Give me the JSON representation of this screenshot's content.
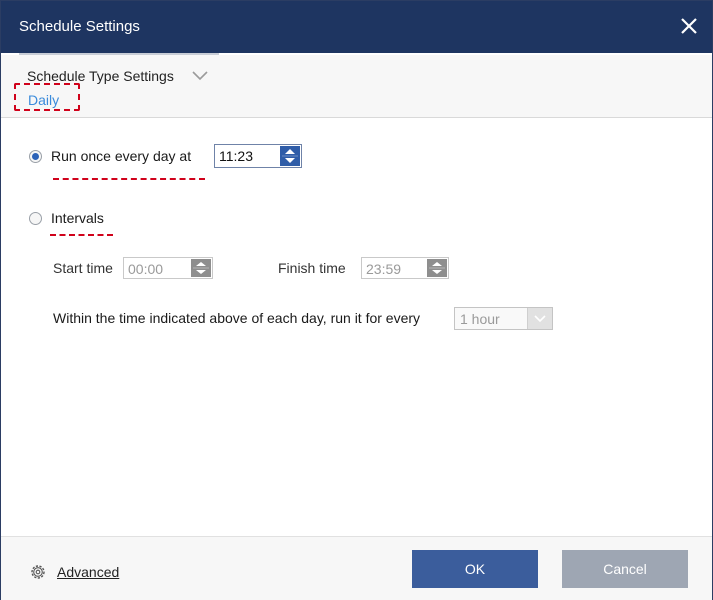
{
  "window": {
    "title": "Schedule Settings"
  },
  "schedule_type": {
    "label": "Schedule Type Settings",
    "selected": "Daily"
  },
  "options": {
    "run_once": {
      "label": "Run once every day at",
      "time": "11:23",
      "selected": true
    },
    "intervals": {
      "label": "Intervals",
      "selected": false
    },
    "start_time": {
      "label": "Start time",
      "value": "00:00"
    },
    "finish_time": {
      "label": "Finish time",
      "value": "23:59"
    },
    "within": {
      "label": "Within the time indicated above of each day, run it for every",
      "value": "1 hour"
    }
  },
  "footer": {
    "advanced_label": "Advanced",
    "ok_label": "OK",
    "cancel_label": "Cancel"
  },
  "colors": {
    "titlebar": "#1e3561",
    "accent": "#2f5da8",
    "link": "#3b8bdb",
    "annotation": "#d0021b"
  }
}
